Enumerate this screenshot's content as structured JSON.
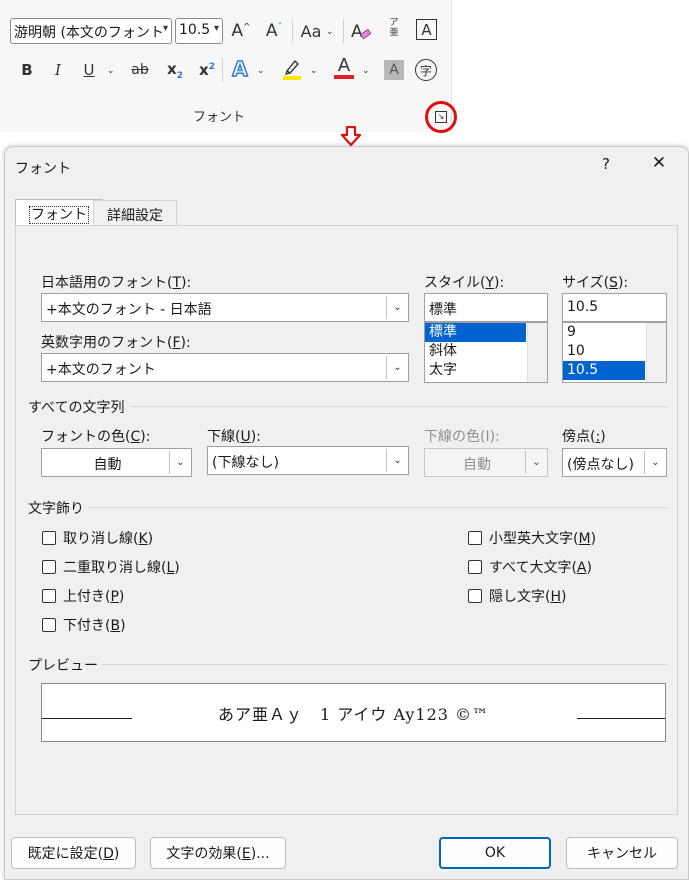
{
  "ribbon": {
    "font_name": "游明朝 (本文のフォント",
    "font_size": "10.5",
    "grow_font": "A",
    "shrink_font": "A",
    "change_case": "Aa",
    "phonetic_top": "ア",
    "phonetic_bottom": "亜",
    "char_border": "A",
    "bold": "B",
    "italic": "I",
    "underline": "U",
    "strikethrough": "ab",
    "subscript_base": "x",
    "subscript_mark": "2",
    "superscript_base": "x",
    "superscript_mark": "2",
    "text_effects": "A",
    "font_color": "A",
    "char_shading": "A",
    "enclose_char": "字",
    "group_label": "フォント",
    "colors": {
      "highlight": "#ffe600",
      "font_color": "#e02020",
      "text_effects": "#2b79d6",
      "launcher_ring": "#e01010"
    }
  },
  "dialog": {
    "title": "フォント",
    "help": "?",
    "close": "✕",
    "tabs": [
      {
        "label": "フォント",
        "active": true
      },
      {
        "label": "詳細設定",
        "active": false
      }
    ],
    "font": {
      "jp_label_pre": "日本語用のフォント(",
      "jp_label_key": "T",
      "jp_label_post": "):",
      "jp_value": "+本文のフォント - 日本語",
      "en_label_pre": "英数字用のフォント(",
      "en_label_key": "F",
      "en_label_post": "):",
      "en_value": "+本文のフォント",
      "style_label_pre": "スタイル(",
      "style_label_key": "Y",
      "style_label_post": "):",
      "style_value": "標準",
      "style_options": [
        "標準",
        "斜体",
        "太字"
      ],
      "size_label_pre": "サイズ(",
      "size_label_key": "S",
      "size_label_post": "):",
      "size_value": "10.5",
      "size_options": [
        "9",
        "10",
        "10.5"
      ]
    },
    "all_text": {
      "section": "すべての文字列",
      "color_label_pre": "フォントの色(",
      "color_label_key": "C",
      "color_label_post": "):",
      "color_value": "自動",
      "underline_label_pre": "下線(",
      "underline_label_key": "U",
      "underline_label_post": "):",
      "underline_value": "(下線なし)",
      "underline_color_label": "下線の色(I):",
      "underline_color_value": "自動",
      "emphasis_label_pre": "傍点(",
      "emphasis_label_key": ":",
      "emphasis_label_post": ")",
      "emphasis_value": "(傍点なし)"
    },
    "effects": {
      "section": "文字飾り",
      "left": [
        {
          "pre": "取り消し線(",
          "key": "K",
          "post": ")"
        },
        {
          "pre": "二重取り消し線(",
          "key": "L",
          "post": ")"
        },
        {
          "pre": "上付き(",
          "key": "P",
          "post": ")"
        },
        {
          "pre": "下付き(",
          "key": "B",
          "post": ")"
        }
      ],
      "right": [
        {
          "pre": "小型英大文字(",
          "key": "M",
          "post": ")"
        },
        {
          "pre": "すべて大文字(",
          "key": "A",
          "post": ")"
        },
        {
          "pre": "隠し文字(",
          "key": "H",
          "post": ")"
        }
      ]
    },
    "preview": {
      "section": "プレビュー",
      "text": "あア亜Ａｙ　1 アイウ Ay123 ©™"
    },
    "buttons": {
      "default_pre": "既定に設定(",
      "default_key": "D",
      "default_post": ")",
      "effects_pre": "文字の効果(",
      "effects_key": "E",
      "effects_post": ")...",
      "ok": "OK",
      "cancel": "キャンセル"
    }
  }
}
